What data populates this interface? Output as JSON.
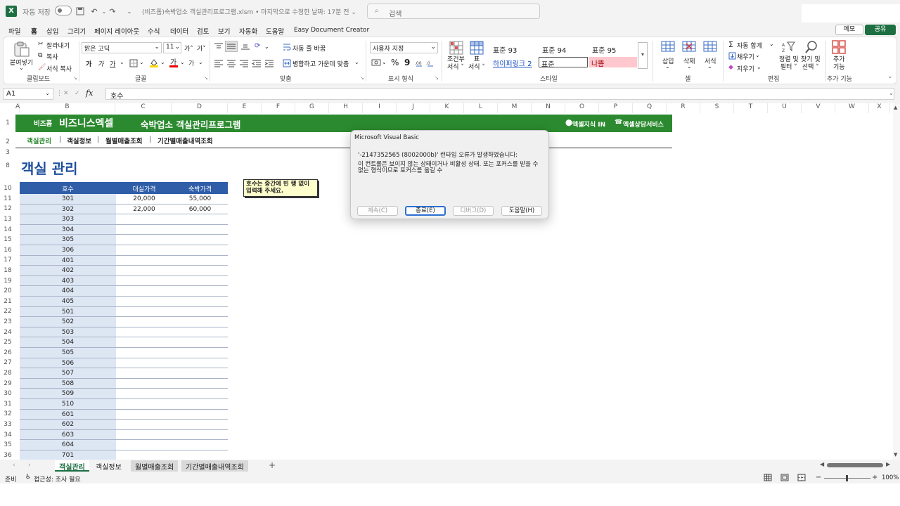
{
  "window": {
    "autosave_label": "자동 저장",
    "autosave_state": "끔",
    "title": "(비즈폼)숙박업소 객실관리프로그램.xlsm • 마지막으로 수정한 날짜: 17분 전 ⌄",
    "search_placeholder": "검색"
  },
  "menu": [
    "파일",
    "홈",
    "삽입",
    "그리기",
    "페이지 레이아웃",
    "수식",
    "데이터",
    "검토",
    "보기",
    "자동화",
    "도움말",
    "Easy Document Creator"
  ],
  "menu_right": {
    "memo": "메모",
    "share": "공유"
  },
  "ribbon": {
    "clipboard": {
      "paste": "붙여넣기",
      "cut": "잘라내기",
      "copy": "복사",
      "format_painter": "서식 복사",
      "group": "클립보드"
    },
    "font": {
      "name": "맑은 고딕",
      "size": "11",
      "grow": "가˄",
      "shrink": "가˅",
      "bold": "가",
      "italic": "가",
      "underline": "가",
      "group": "글꼴"
    },
    "align": {
      "wrap": "자동 줄 바꿈",
      "merge": "병합하고 가운데 맞춤",
      "group": "맞춤"
    },
    "number": {
      "format": "사용자 지정",
      "percent": "%",
      "comma": "9",
      "group": "표시 형식"
    },
    "styles": {
      "cond": "조건부\n서식 ˅",
      "table": "표\n서식 ˅",
      "s93": "표준 93",
      "s94": "표준 94",
      "s95": "표준 95",
      "link2": "하이퍼링크 2",
      "normal": "표준",
      "bad": "나쁨",
      "group": "스타일"
    },
    "cells": {
      "insert": "삽입",
      "delete": "삭제",
      "format": "서식",
      "group": "셀"
    },
    "editing": {
      "autosum": "자동 합계",
      "fill": "채우기",
      "clear": "지우기",
      "sort": "정렬 및\n필터 ˅",
      "find": "찾기 및\n선택 ˅",
      "group": "편집"
    },
    "addins": {
      "label": "추가\n기능",
      "group": "추가 기능"
    }
  },
  "formula_bar": {
    "cell": "A1",
    "fx": "fx",
    "value": "호수"
  },
  "columns": [
    "A",
    "B",
    "C",
    "D",
    "E",
    "F",
    "G",
    "H",
    "I",
    "J",
    "K",
    "L",
    "M",
    "N",
    "O",
    "P",
    "Q",
    "R",
    "S",
    "T",
    "U",
    "V",
    "W",
    "X"
  ],
  "sheet": {
    "brand_small": "비즈폼",
    "brand": "비즈니스엑셀",
    "title": "숙박업소 객실관리프로그램",
    "link1": "엑셀지식 IN",
    "link2": "엑셀상담서비스",
    "nav": [
      "객실관리",
      "객실정보",
      "월별매출조회",
      "기간별매출내역조회"
    ],
    "page_title": "객실 관리",
    "note": "호수는 중간에 빈 행 없이 입력해 주세요.",
    "headers": [
      "호수",
      "대실가격",
      "숙박가격"
    ],
    "rows": [
      {
        "r": "11",
        "room": "301",
        "day": "20,000",
        "night": "55,000"
      },
      {
        "r": "12",
        "room": "302",
        "day": "22,000",
        "night": "60,000"
      },
      {
        "r": "13",
        "room": "303"
      },
      {
        "r": "14",
        "room": "304"
      },
      {
        "r": "15",
        "room": "305"
      },
      {
        "r": "16",
        "room": "306"
      },
      {
        "r": "17",
        "room": "401"
      },
      {
        "r": "18",
        "room": "402"
      },
      {
        "r": "19",
        "room": "403"
      },
      {
        "r": "20",
        "room": "404"
      },
      {
        "r": "21",
        "room": "405"
      },
      {
        "r": "22",
        "room": "501"
      },
      {
        "r": "23",
        "room": "502"
      },
      {
        "r": "24",
        "room": "503"
      },
      {
        "r": "25",
        "room": "504"
      },
      {
        "r": "26",
        "room": "505"
      },
      {
        "r": "27",
        "room": "506"
      },
      {
        "r": "28",
        "room": "507"
      },
      {
        "r": "29",
        "room": "508"
      },
      {
        "r": "30",
        "room": "509"
      },
      {
        "r": "31",
        "room": "510"
      },
      {
        "r": "32",
        "room": "601"
      },
      {
        "r": "33",
        "room": "602"
      },
      {
        "r": "34",
        "room": "603"
      },
      {
        "r": "35",
        "room": "604"
      },
      {
        "r": "36",
        "room": "701"
      }
    ]
  },
  "dialog": {
    "title": "Microsoft Visual Basic",
    "error": "'-2147352565 (8002000b)' 런타임 오류가 발생하였습니다:",
    "message": "이 컨트롤은 보이지 않는 상태이거나 비활성 상태. 또는 포커스를 받을 수 없는 형식이므로 포커스를 옮길 수",
    "continue": "계속(C)",
    "end": "종료(E)",
    "debug": "디버그(D)",
    "help": "도움말(H)"
  },
  "tabs": [
    "객실관리",
    "객실정보",
    "월별매출조회",
    "기간별매출내역조회"
  ],
  "status": {
    "ready": "준비",
    "accessibility": "접근성: 조사 필요",
    "zoom": "100%"
  },
  "colors": {
    "green": "#2b8a2f",
    "blue_header": "#2f5da8",
    "note_bg": "#ffffcc"
  }
}
